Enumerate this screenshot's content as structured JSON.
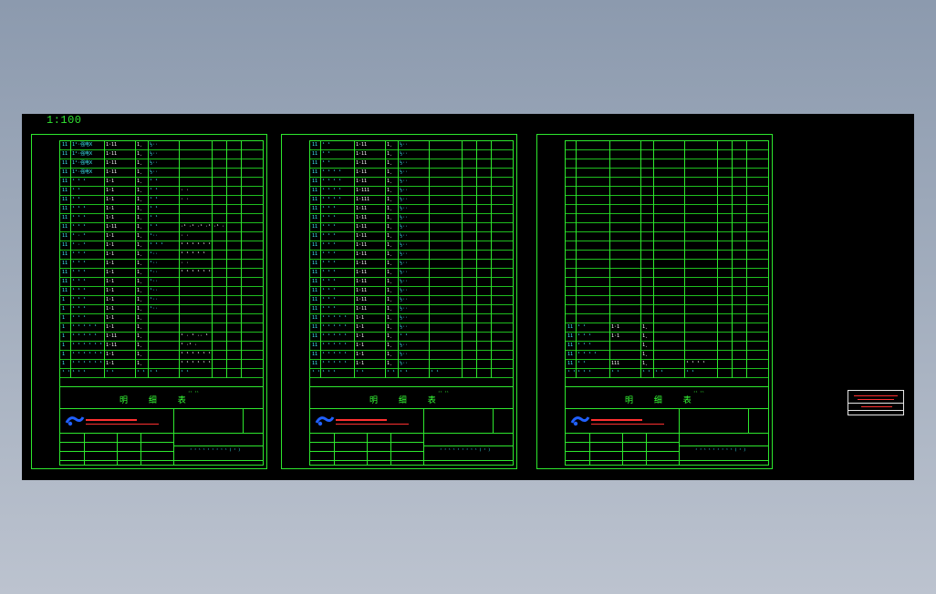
{
  "scale_label": "1:100",
  "sheets": [
    {
      "id": "sheet-1",
      "rows": [
        [
          "11",
          "1¹·强电X",
          "1·11",
          "1¸",
          "½··",
          ""
        ],
        [
          "11",
          "1¹·强电X",
          "1·11",
          "1¸",
          "½··",
          ""
        ],
        [
          "11",
          "1¹·强电X",
          "1·11",
          "1¸",
          "½··",
          ""
        ],
        [
          "11",
          "1¹·强电X",
          "1·11",
          "1¸",
          "½··",
          ""
        ],
        [
          "11",
          "¹ ¹ ¹",
          "1·1",
          "1¸",
          "¹ ¹",
          ""
        ],
        [
          "11",
          "¹ ¹",
          "1·1",
          "1¸",
          "¹ ¹",
          "· ·"
        ],
        [
          "11",
          "¹ ¹",
          "1·1",
          "1¸",
          "¹ ¹",
          "· ·"
        ],
        [
          "11",
          "¹ ¹ ¹",
          "1·1",
          "1¸",
          "¹ ¹",
          ""
        ],
        [
          "11",
          "¹ ¹ ¹",
          "1·1",
          "1¸",
          "¹ ¹",
          ""
        ],
        [
          "11",
          "¹ ¹ ¹",
          "1·11",
          "1¸",
          "¹ ¹",
          "·¹ ·¹ ·¹ ·¹ ·¹ ·¹ ·¹ ·¹"
        ],
        [
          "11",
          "¹ · ¹",
          "1·1",
          "1¸",
          "¹··",
          "· ·"
        ],
        [
          "11",
          "¹ · ¹",
          "1·1",
          "1¸",
          "¹ ¹ ¹",
          "¹ ¹ ¹ ¹ ¹ ¹"
        ],
        [
          "11",
          "¹ ¹ ¹",
          "1·1",
          "1¸",
          "¹··",
          "¹ ¹ ¹ ¹ ¹"
        ],
        [
          "11",
          "¹ ¹ ¹",
          "1·1",
          "1¸",
          "¹··",
          "· ·"
        ],
        [
          "11",
          "¹ ¹ ¹",
          "1·1",
          "1¸",
          "¹··",
          "¹ ¹ ¹ ¹ ¹ ¹"
        ],
        [
          "11",
          "¹ ¹ ¹",
          "1·1",
          "1¸",
          "¹··",
          ""
        ],
        [
          "11",
          "¹ ¹ ¹",
          "1·1",
          "1¸",
          "¹··",
          ""
        ],
        [
          "1",
          "¹ ¹ ¹",
          "1·1",
          "1¸",
          "¹··",
          ""
        ],
        [
          "1",
          "¹ ¹ ¹",
          "1·1",
          "1¸",
          "¹··",
          ""
        ],
        [
          "1",
          "¹ ¹ ¹",
          "1·1",
          "1¸",
          "",
          ""
        ],
        [
          "1",
          "¹ ¹ ¹ ¹ ¹",
          "1·1",
          "1¸",
          "",
          ""
        ],
        [
          "1",
          "¹ ¹ ¹ ¹ ¹",
          "1·11",
          "1¸",
          "",
          "¹ · ¹ ·· ¹ ·"
        ],
        [
          "1",
          "¹ ¹ ¹ ¹ ¹ ¹",
          "1·11",
          "1¸",
          "",
          "¹ ·¹ ·"
        ],
        [
          "1",
          "¹ ¹ ¹ ¹ ¹ ¹",
          "1·1",
          "1¸",
          "",
          "¹ ¹ ¹ ¹ ¹ ¹"
        ],
        [
          "1",
          "¹ ¹ ¹ ¹ ¹ ¹",
          "1·1",
          "1¸",
          "",
          "¹ ¹ ¹ ¹ ¹ ¹"
        ]
      ],
      "header": [
        "¹ ¹",
        "¹ ¹ ¹",
        "¹ ¹",
        "¹ ¹",
        "¹ ¹",
        "¹ ¹"
      ],
      "title": "明 细 表",
      "subtitle": "¹¹ ¹¹",
      "sheet_label": "¹ ¹ ¹ ¹ ¹ ¹ ¹ ¹ ¹ ( ¹ )"
    },
    {
      "id": "sheet-2",
      "rows": [
        [
          "11",
          "¹ ¹",
          "1·11",
          "1¸",
          "½··",
          ""
        ],
        [
          "11",
          "¹ ¹",
          "1·11",
          "1¸",
          "½··",
          ""
        ],
        [
          "11",
          "¹ ¹",
          "1·11",
          "1¸",
          "½··",
          ""
        ],
        [
          "11",
          "¹ ¹ ¹ ¹",
          "1·11",
          "1¸",
          "½··",
          ""
        ],
        [
          "11",
          "¹ ¹ ¹ ¹",
          "1·11",
          "1¸",
          "½··",
          ""
        ],
        [
          "11",
          "¹ ¹ ¹ ¹",
          "1·111",
          "1¸",
          "½··",
          ""
        ],
        [
          "11",
          "¹ ¹ ¹ ¹",
          "1·111",
          "1¸",
          "½··",
          ""
        ],
        [
          "11",
          "¹ ¹ ¹",
          "1·11",
          "1¸",
          "½··",
          ""
        ],
        [
          "11",
          "¹ ¹ ¹",
          "1·11",
          "1¸",
          "½··",
          ""
        ],
        [
          "11",
          "¹ ¹ ¹",
          "1·11",
          "1¸",
          "½··",
          ""
        ],
        [
          "11",
          "¹ ¹ ¹",
          "1·11",
          "1¸",
          "½··",
          ""
        ],
        [
          "11",
          "¹ ¹ ¹",
          "1·11",
          "1¸",
          "½··",
          ""
        ],
        [
          "11",
          "¹ ¹ ¹",
          "1·11",
          "1¸",
          "½··",
          ""
        ],
        [
          "11",
          "¹ ¹ ¹",
          "1·11",
          "1¸",
          "½··",
          ""
        ],
        [
          "11",
          "¹ ¹ ¹",
          "1·11",
          "1¸",
          "½··",
          ""
        ],
        [
          "11",
          "¹ ¹ ¹",
          "1·11",
          "1¸",
          "½··",
          ""
        ],
        [
          "11",
          "¹ ¹ ¹",
          "1·11",
          "1¸",
          "½··",
          ""
        ],
        [
          "11",
          "¹ ¹ ¹",
          "1·11",
          "1¸",
          "½··",
          ""
        ],
        [
          "11",
          "¹ ¹ ¹",
          "1·11",
          "1¸",
          "½··",
          ""
        ],
        [
          "11",
          "¹ ¹ ¹ ¹ ¹",
          "1·1",
          "1¸",
          "½··",
          ""
        ],
        [
          "11",
          "¹ ¹ ¹ ¹ ¹",
          "1·1",
          "1¸",
          "½··",
          ""
        ],
        [
          "11",
          "¹ ¹ ¹ ¹ ¹",
          "1·1",
          "1¸",
          "¹ ¹",
          ""
        ],
        [
          "11",
          "¹ ¹ ¹ ¹ ¹",
          "1·1",
          "1¸",
          "½··",
          ""
        ],
        [
          "11",
          "¹ ¹ ¹ ¹ ¹",
          "1·1",
          "1¸",
          "½··",
          ""
        ],
        [
          "11",
          "¹ ¹ ¹ ¹ ¹",
          "1·1",
          "1¸",
          "½··",
          ""
        ]
      ],
      "header": [
        "¹ ¹",
        "¹ ¹ ¹",
        "¹ ¹",
        "¹ ¹",
        "¹ ¹",
        "¹ ¹"
      ],
      "title": "明 细 表",
      "subtitle": "¹¹ ¹¹",
      "sheet_label": "¹ ¹ ¹ ¹ ¹ ¹ ¹ ¹ ¹ ( ¹ )"
    },
    {
      "id": "sheet-3",
      "rows": [
        [
          "",
          "",
          "",
          "",
          "",
          ""
        ],
        [
          "",
          "",
          "",
          "",
          "",
          ""
        ],
        [
          "",
          "",
          "",
          "",
          "",
          ""
        ],
        [
          "",
          "",
          "",
          "",
          "",
          ""
        ],
        [
          "",
          "",
          "",
          "",
          "",
          ""
        ],
        [
          "",
          "",
          "",
          "",
          "",
          ""
        ],
        [
          "",
          "",
          "",
          "",
          "",
          ""
        ],
        [
          "",
          "",
          "",
          "",
          "",
          ""
        ],
        [
          "",
          "",
          "",
          "",
          "",
          ""
        ],
        [
          "",
          "",
          "",
          "",
          "",
          ""
        ],
        [
          "",
          "",
          "",
          "",
          "",
          ""
        ],
        [
          "",
          "",
          "",
          "",
          "",
          ""
        ],
        [
          "",
          "",
          "",
          "",
          "",
          ""
        ],
        [
          "",
          "",
          "",
          "",
          "",
          ""
        ],
        [
          "",
          "",
          "",
          "",
          "",
          ""
        ],
        [
          "",
          "",
          "",
          "",
          "",
          ""
        ],
        [
          "",
          "",
          "",
          "",
          "",
          ""
        ],
        [
          "",
          "",
          "",
          "",
          "",
          ""
        ],
        [
          "",
          "",
          "",
          "",
          "",
          ""
        ],
        [
          "",
          "",
          "",
          "",
          "",
          ""
        ],
        [
          "11",
          "¹ ¹",
          "1·1",
          "1¸",
          "",
          ""
        ],
        [
          "11",
          "¹ ¹ ¹",
          "1·1",
          "1¸",
          "",
          ""
        ],
        [
          "11",
          "¹ ¹ ¹",
          "",
          "1¸",
          "",
          ""
        ],
        [
          "11",
          "¹ ¹ ¹ ¹",
          "",
          "1¸",
          "",
          ""
        ],
        [
          "11",
          "¹ ¹",
          "111",
          "1¸",
          "",
          "¹ ¹ ¹ ¹"
        ]
      ],
      "header": [
        "¹ ¹",
        "¹ ¹ ¹",
        "¹ ¹",
        "¹ ¹",
        "¹ ¹",
        "¹ ¹"
      ],
      "title": "明 细 表",
      "subtitle": "¹¹ ¹¹",
      "sheet_label": "¹ ¹ ¹ ¹ ¹ ¹ ¹ ¹ ¹ ( ¹ )"
    }
  ],
  "colors": {
    "frame": "#2ee82e",
    "text_cyan": "#3ff2ff",
    "text_white": "#ffffff",
    "company_red": "#ff3030",
    "logo_blue": "#2060ff"
  }
}
